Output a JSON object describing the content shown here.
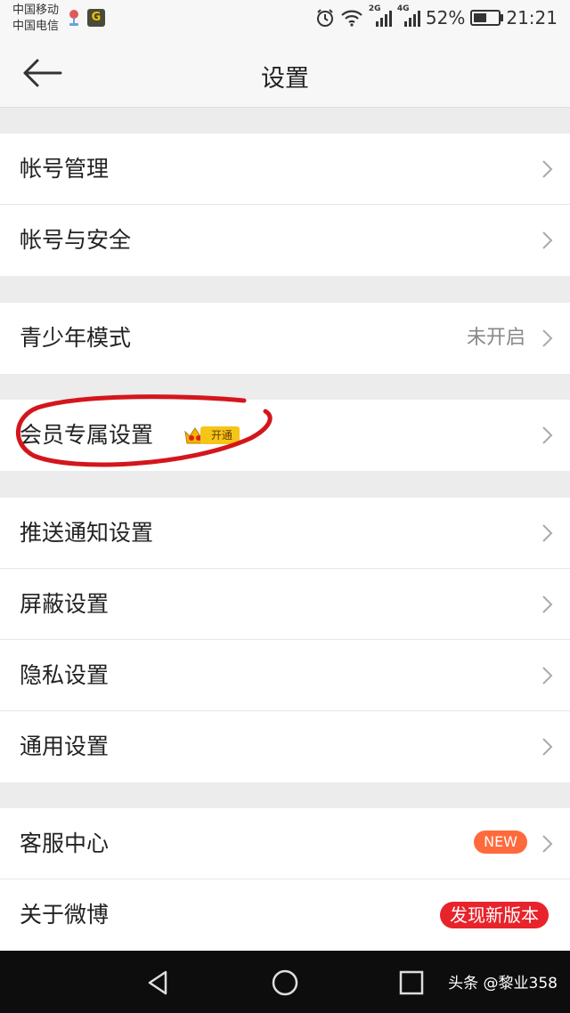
{
  "status_bar": {
    "carrier_1": "中国移动",
    "carrier_2": "中国电信",
    "app_icon": "G",
    "battery_percent": "52%",
    "battery_level": 0.52,
    "time": "21:21",
    "net_1": "2G",
    "net_2": "4G"
  },
  "nav": {
    "title": "设置",
    "back_icon": "arrow-left-icon"
  },
  "sections": [
    {
      "rows": [
        {
          "label": "帐号管理"
        },
        {
          "label": "帐号与安全"
        }
      ]
    },
    {
      "rows": [
        {
          "label": "青少年模式",
          "value": "未开启"
        }
      ]
    },
    {
      "rows": [
        {
          "label": "会员专属设置",
          "badge": "开通"
        }
      ]
    },
    {
      "rows": [
        {
          "label": "推送通知设置"
        },
        {
          "label": "屏蔽设置"
        },
        {
          "label": "隐私设置"
        },
        {
          "label": "通用设置"
        }
      ]
    },
    {
      "rows": [
        {
          "label": "客服中心",
          "badge": "NEW"
        },
        {
          "label": "关于微博",
          "badge": "发现新版本"
        }
      ]
    }
  ],
  "watermark": "头条 @黎业358",
  "colors": {
    "new_badge": "#ff6a3d",
    "update_badge": "#e8232b",
    "annotation": "#d4161c",
    "vip_badge": "#f5c518"
  }
}
